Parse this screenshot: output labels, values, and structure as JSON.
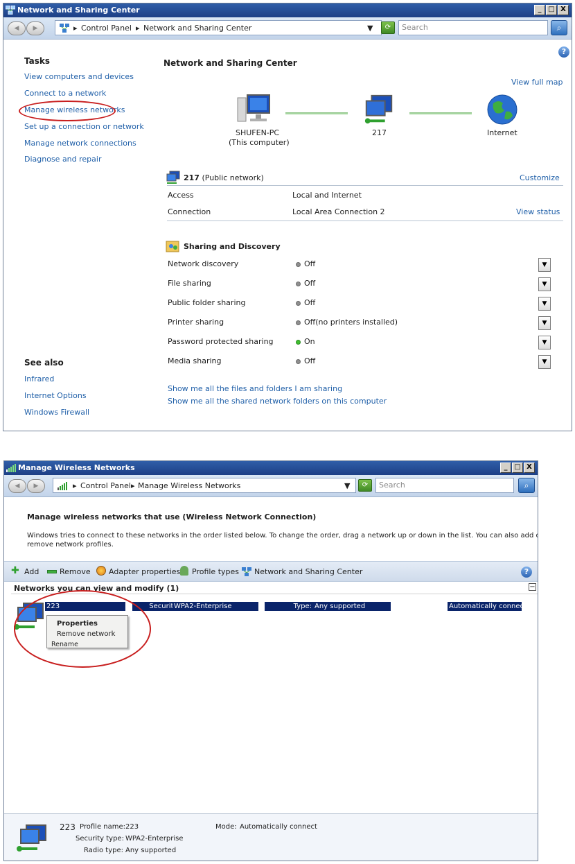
{
  "colors": {
    "link": "#1f5fa8",
    "title_bar": "#1d3f86",
    "selection": "#0a246a",
    "annotation_red": "#c81e1e"
  },
  "win1": {
    "title": "Network and Sharing Center",
    "buttons": {
      "minimize": "_",
      "maximize": "□",
      "close": "X"
    },
    "address": {
      "crumb1": "Control Panel",
      "crumb2": "Network and Sharing Center",
      "search_placeholder": "Search"
    },
    "tasks": {
      "heading": "Tasks",
      "items": [
        "View computers and devices",
        "Connect to a network",
        "Manage wireless networks",
        "Set up a connection or network",
        "Manage network connections",
        "Diagnose and repair"
      ]
    },
    "see_also": {
      "heading": "See also",
      "items": [
        "Infrared",
        "Internet Options",
        "Windows Firewall"
      ]
    },
    "main_title": "Network and Sharing Center",
    "view_full_map": "View full map",
    "map": {
      "pc_name": "SHUFEN-PC",
      "pc_sub": "(This computer)",
      "network": "217",
      "internet": "Internet"
    },
    "network": {
      "name": "217",
      "type": "(Public network)",
      "customize": "Customize",
      "rows": [
        {
          "label": "Access",
          "value": "Local and Internet",
          "action": ""
        },
        {
          "label": "Connection",
          "value": "Local Area Connection 2",
          "action": "View status"
        }
      ]
    },
    "sharing": {
      "heading": "Sharing and Discovery",
      "rows": [
        {
          "label": "Network discovery",
          "value": "Off",
          "on": false
        },
        {
          "label": "File sharing",
          "value": "Off",
          "on": false
        },
        {
          "label": "Public folder sharing",
          "value": "Off",
          "on": false
        },
        {
          "label": "Printer sharing",
          "value": "Off(no printers installed)",
          "on": false
        },
        {
          "label": "Password protected sharing",
          "value": "On",
          "on": true
        },
        {
          "label": "Media sharing",
          "value": "Off",
          "on": false
        }
      ]
    },
    "bottom_links": [
      "Show me all the files and folders I am sharing",
      "Show me all the shared network folders on this computer"
    ]
  },
  "win2": {
    "title": "Manage Wireless Networks",
    "buttons": {
      "minimize": "_",
      "maximize": "□",
      "close": "X"
    },
    "address": {
      "crumb1": "Control Panel",
      "crumb2": "Manage Wireless Networks",
      "search_placeholder": "Search"
    },
    "heading": "Manage wireless networks that use (Wireless Network Connection)",
    "description_line1": "Windows tries to connect to these networks in the order listed below. To change the order, drag a network up or down in the list. You can also add or",
    "description_line2": "remove network profiles.",
    "toolbar": {
      "add": "Add",
      "remove": "Remove",
      "adapter": "Adapter properties",
      "profile_types": "Profile types",
      "nsc": "Network and Sharing Center"
    },
    "group_header": "Networks you can view and modify (1)",
    "collapse_glyph": "−",
    "network_row": {
      "name": "223",
      "security_label": "Security:",
      "security_value": "WPA2-Enterprise",
      "type_label": "Type:",
      "type_value": "Any supported",
      "mode": "Automatically connect"
    },
    "context_menu": [
      "Properties",
      "Remove network",
      "Rename"
    ],
    "details": {
      "name": "223",
      "profile_label": "Profile name:",
      "profile_value": "223",
      "mode_label": "Mode:",
      "mode_value": "Automatically connect",
      "security_label": "Security type:",
      "security_value": "WPA2-Enterprise",
      "radio_label": "Radio type:",
      "radio_value": "Any supported"
    }
  }
}
